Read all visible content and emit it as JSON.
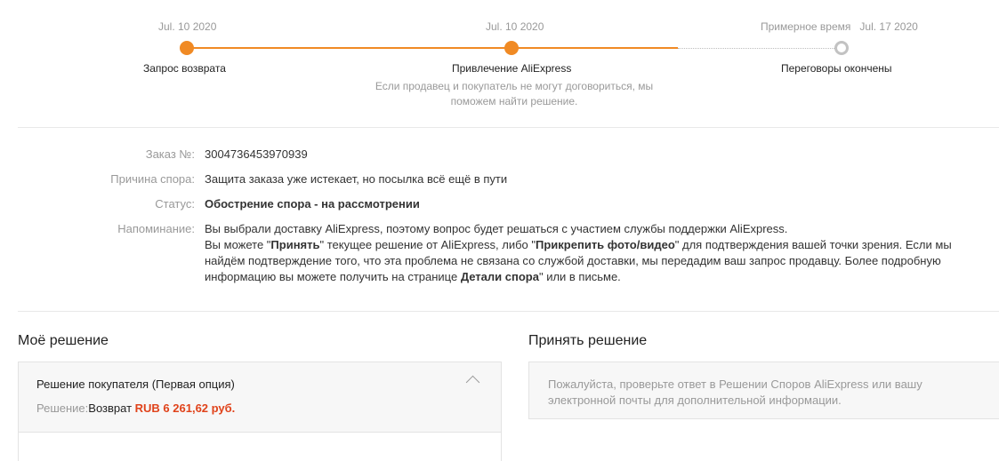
{
  "timeline": {
    "steps": [
      {
        "date": "Jul. 10 2020",
        "label": "Запрос возврата"
      },
      {
        "date": "Jul. 10 2020",
        "label": "Привлечение AliExpress",
        "note": "Если продавец и покупатель не могут договориться, мы поможем найти решение."
      },
      {
        "date_prefix": "Примерное время",
        "date": "Jul. 17 2020",
        "label": "Переговоры окончены"
      }
    ]
  },
  "details": {
    "order_label": "Заказ №:",
    "order_value": "3004736453970939",
    "reason_label": "Причина спора:",
    "reason_value": "Защита заказа уже истекает, но посылка всё ещё в пути",
    "status_label": "Статус:",
    "status_value": "Обострение спора - на рассмотрении",
    "reminder_label": "Напоминание:",
    "reminder_line1": "Вы выбрали доставку AliExpress, поэтому вопрос будет решаться с участием службы поддержки AliExpress.",
    "reminder_p1": "Вы можете \"",
    "reminder_accept": "Принять",
    "reminder_p2": "\" текущее решение от AliExpress, либо \"",
    "reminder_attach": "Прикрепить фото/видео",
    "reminder_p3": "\" для подтверждения вашей точки зрения. Если мы найдём подтверждение того, что эта проблема не связана со службой доставки, мы передадим ваш запрос продавцу. Более подробную информацию вы можете получить на странице ",
    "reminder_details": "Детали спора",
    "reminder_p4": "\" или в письме."
  },
  "my_decision": {
    "title": "Моё решение",
    "card_title": "Решение покупателя (Первая опция)",
    "solution_label": "Решение:",
    "solution_action": "Возврат ",
    "solution_amount": "RUB 6 261,62 руб."
  },
  "accept_decision": {
    "title": "Принять решение",
    "message": "Пожалуйста, проверьте ответ в Решении Споров AliExpress или вашу электронной почты для дополнительной информации."
  },
  "colors": {
    "accent": "#f08a24",
    "status": "#1a9a1a",
    "amount": "#e0431b"
  }
}
